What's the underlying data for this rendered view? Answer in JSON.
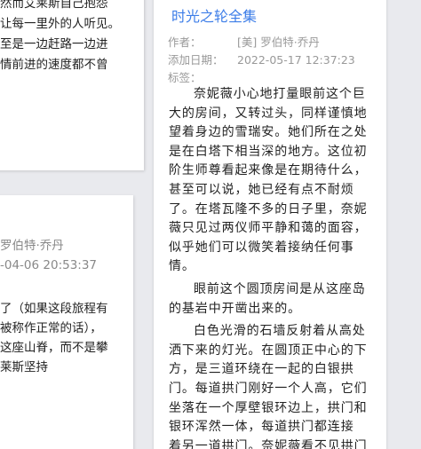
{
  "left_top_card": {
    "lines": [
      "然而艾莱斯自己抱怨",
      "让每一里外的人听见。",
      "至是一边赶路一边进",
      "情前进的速度都不曾"
    ]
  },
  "left_bottom_card": {
    "author": "罗伯特·乔丹",
    "date": "-04-06 20:53:37",
    "lines": [
      "了（如果这段旅程有",
      "被称作正常的话），",
      "这座山脊，而不是攀",
      "莱斯坚持"
    ]
  },
  "right_card": {
    "title": "时光之轮全集",
    "author_label": "作者：",
    "author_value": "[美] 罗伯特·乔丹",
    "date_label": "添加日期：",
    "date_value": "2022-05-17 12:37:23",
    "tags_label": "标签：",
    "tags_value": "",
    "paragraphs": [
      {
        "lines": [
          "奈妮薇小心地打量眼前这个巨",
          "大的房间，又转过头，同样谨慎地",
          "望着身边的雪瑞安。她们所在之处",
          "是在白塔下相当深的地方。这位初",
          "阶生师尊看起来像是在期待什么，",
          "甚至可以说，她已经有点不耐烦",
          "了。在塔瓦隆不多的日子里，奈妮",
          "薇只见过两仪师平静和蔼的面容，",
          "似乎她们可以微笑着接纳任何事",
          "情。"
        ]
      },
      {
        "lines": [
          "眼前这个圆顶房间是从这座岛",
          "的基岩中开凿出来的。"
        ]
      },
      {
        "lines": [
          "白色光滑的石墙反射着从高处",
          "洒下来的灯光。在圆顶正中心的下",
          "方，是三道环绕在一起的白银拱",
          "门。每道拱门刚好一个人高，它们",
          "坐落在一个厚壁银环边上，拱门和",
          "银环浑然一体，每道拱门都连接",
          "着另一道拱门。奈妮薇看不见拱门"
        ]
      }
    ]
  }
}
